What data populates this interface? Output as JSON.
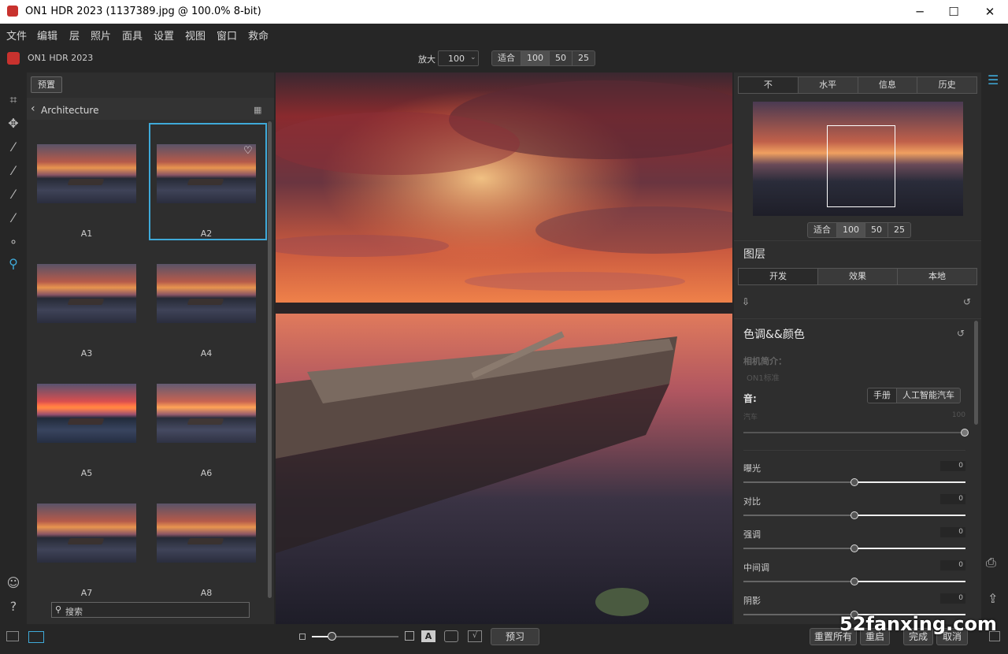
{
  "window": {
    "title": "ON1 HDR 2023 (1137389.jpg @ 100.0% 8-bit)",
    "minimize": "─",
    "maximize": "☐",
    "close": "✕"
  },
  "menu": [
    "文件",
    "编辑",
    "层",
    "照片",
    "面具",
    "设置",
    "视图",
    "窗口",
    "救命"
  ],
  "topbar": {
    "app_name": "ON1 HDR 2023",
    "zoom_label": "放大",
    "zoom_value": "100",
    "zoom_modes": [
      "适合",
      "100",
      "50",
      "25"
    ]
  },
  "browser": {
    "preset_button": "预置",
    "folder": "Architecture",
    "thumbnails": [
      "A1",
      "A2",
      "A3",
      "A4",
      "A5",
      "A6",
      "A7",
      "A8"
    ],
    "selected": "A2",
    "search_placeholder": "搜索"
  },
  "right": {
    "nav_tabs": [
      "不",
      "水平",
      "信息",
      "历史"
    ],
    "nav_zoom": [
      "适合",
      "100",
      "50",
      "25"
    ],
    "layers_title": "图层",
    "mode_tabs": [
      "开发",
      "效果",
      "本地"
    ],
    "section_title": "色调&&颜色",
    "camera_profile_label": "相机简介：",
    "camera_profile_value": "ON1标准",
    "tone_label": "音:",
    "tone_modes": [
      "手册",
      "人工智能汽车"
    ],
    "auto_label": "汽车",
    "auto_value": "100",
    "sliders": [
      {
        "label": "曝光",
        "value": "0"
      },
      {
        "label": "对比",
        "value": "0"
      },
      {
        "label": "强调",
        "value": "0"
      },
      {
        "label": "中间调",
        "value": "0"
      },
      {
        "label": "阴影",
        "value": "0"
      }
    ]
  },
  "bottom": {
    "preview_button": "预习",
    "reset_all": "重置所有",
    "reset": "重启",
    "done": "完成",
    "cancel": "取消",
    "watermark": "52fanxing.com"
  },
  "colors": {
    "accent": "#3fa9d8",
    "panel": "#2e2e2e",
    "bg": "#262626"
  }
}
